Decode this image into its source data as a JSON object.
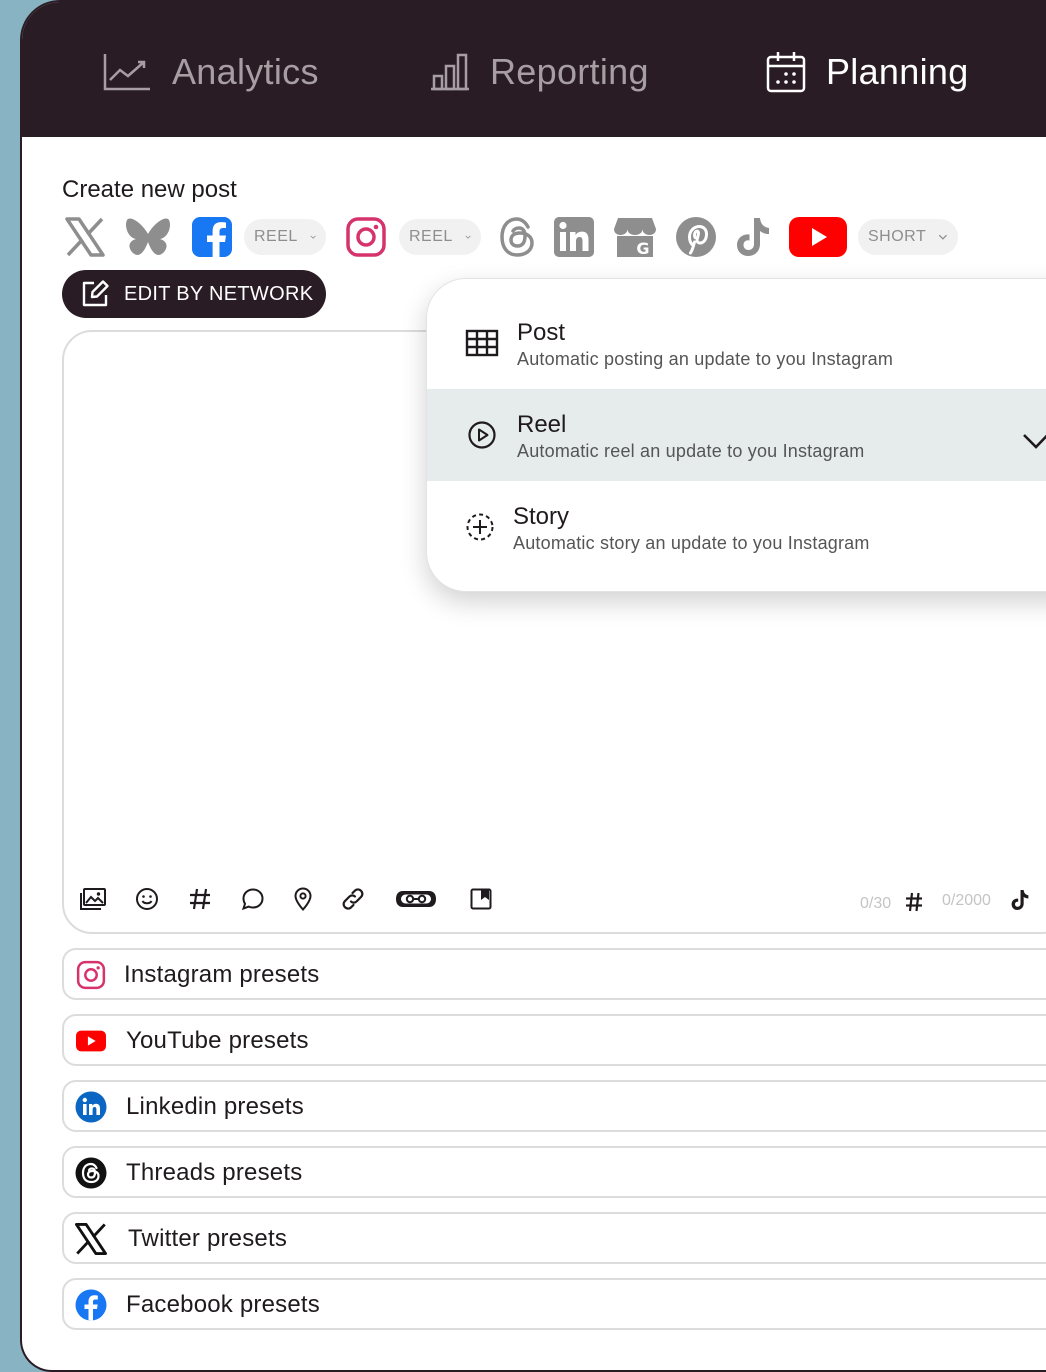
{
  "nav": {
    "tabs": [
      {
        "label": "Analytics",
        "icon": "analytics-chart-icon",
        "active": false
      },
      {
        "label": "Reporting",
        "icon": "bar-chart-icon",
        "active": false
      },
      {
        "label": "Planning",
        "icon": "calendar-icon",
        "active": true
      }
    ]
  },
  "composer": {
    "title": "Create new post",
    "networks": [
      {
        "name": "x",
        "icon": "x-icon"
      },
      {
        "name": "bluesky",
        "icon": "bluesky-icon"
      },
      {
        "name": "facebook",
        "icon": "facebook-icon",
        "format": "REEL"
      },
      {
        "name": "instagram",
        "icon": "instagram-icon",
        "format": "REEL"
      },
      {
        "name": "threads",
        "icon": "threads-icon"
      },
      {
        "name": "linkedin",
        "icon": "linkedin-icon"
      },
      {
        "name": "google-business",
        "icon": "google-business-icon"
      },
      {
        "name": "pinterest",
        "icon": "pinterest-icon"
      },
      {
        "name": "tiktok",
        "icon": "tiktok-icon"
      },
      {
        "name": "youtube",
        "icon": "youtube-icon",
        "format": "SHORT"
      }
    ],
    "edit_by_network_label": "EDIT BY NETWORK",
    "toolbar_icons": [
      "image-icon",
      "emoji-icon",
      "hashtag-icon",
      "comment-icon",
      "location-icon",
      "link-icon",
      "ai-assistant-icon",
      "bookmark-icon"
    ],
    "hashtag_counter": "0/30",
    "char_counter": "0/2000"
  },
  "format_menu": {
    "options": [
      {
        "title": "Post",
        "description": "Automatic posting an update to you Instagram",
        "icon": "grid-icon",
        "selected": false
      },
      {
        "title": "Reel",
        "description": "Automatic reel an update to you Instagram",
        "icon": "play-circle-icon",
        "selected": true
      },
      {
        "title": "Story",
        "description": "Automatic story an update to you Instagram",
        "icon": "story-add-icon",
        "selected": false
      }
    ]
  },
  "presets": [
    {
      "label": "Instagram presets",
      "icon": "instagram-icon"
    },
    {
      "label": "YouTube presets",
      "icon": "youtube-icon"
    },
    {
      "label": "Linkedin presets",
      "icon": "linkedin-icon"
    },
    {
      "label": "Threads presets",
      "icon": "threads-icon"
    },
    {
      "label": "Twitter presets",
      "icon": "x-icon"
    },
    {
      "label": "Facebook presets",
      "icon": "facebook-icon"
    }
  ],
  "colors": {
    "header_bg": "#2a1c25",
    "instagram": "#d6336c",
    "facebook": "#1877f2",
    "youtube": "#ff0000",
    "linkedin": "#0a66c2",
    "selected_option_bg": "#e6ecec"
  }
}
